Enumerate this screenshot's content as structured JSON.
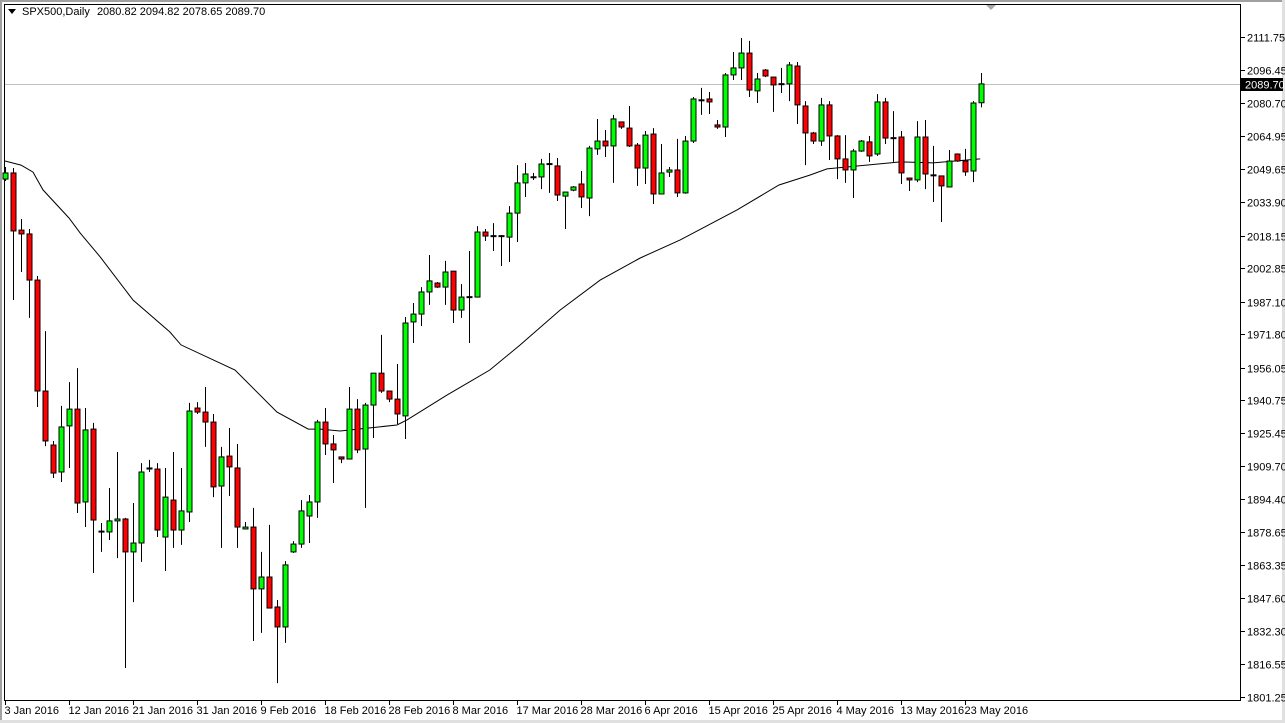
{
  "header": {
    "symbol": "SPX500,Daily",
    "open": "2080.82",
    "high": "2094.82",
    "low": "2078.65",
    "close": "2089.70"
  },
  "colors": {
    "bull": "#00ff00",
    "bear": "#ff0000",
    "outline": "#000000",
    "ma": "#000000",
    "price_line": "#c0c0c0"
  },
  "chart_data": {
    "type": "candlestick",
    "title": "SPX500,Daily",
    "xlabel": "",
    "ylabel": "",
    "ylim": [
      1801.25,
      2111.75
    ],
    "grid": false,
    "current_price": "2089.70",
    "y_ticks": [
      "2111.75",
      "2096.45",
      "2080.70",
      "2064.95",
      "2049.65",
      "2033.90",
      "2018.15",
      "2002.85",
      "1987.10",
      "1971.80",
      "1956.05",
      "1940.75",
      "1925.45",
      "1909.70",
      "1894.40",
      "1878.65",
      "1863.35",
      "1847.60",
      "1832.30",
      "1816.55",
      "1801.25"
    ],
    "x_ticks": [
      {
        "bar": 0,
        "label": "3 Jan 2016"
      },
      {
        "bar": 8,
        "label": "12 Jan 2016"
      },
      {
        "bar": 16,
        "label": "21 Jan 2016"
      },
      {
        "bar": 24,
        "label": "31 Jan 2016"
      },
      {
        "bar": 32,
        "label": "9 Feb 2016"
      },
      {
        "bar": 40,
        "label": "18 Feb 2016"
      },
      {
        "bar": 48,
        "label": "28 Feb 2016"
      },
      {
        "bar": 56,
        "label": "8 Mar 2016"
      },
      {
        "bar": 64,
        "label": "17 Mar 2016"
      },
      {
        "bar": 72,
        "label": "28 Mar 2016"
      },
      {
        "bar": 80,
        "label": "6 Apr 2016"
      },
      {
        "bar": 88,
        "label": "15 Apr 2016"
      },
      {
        "bar": 96,
        "label": "25 Apr 2016"
      },
      {
        "bar": 104,
        "label": "4 May 2016"
      },
      {
        "bar": 112,
        "label": "13 May 2016"
      },
      {
        "bar": 120,
        "label": "23 May 2016"
      }
    ],
    "ohlc_fields": [
      "open",
      "high",
      "low",
      "close"
    ],
    "ohlc": [
      [
        2044.9,
        2050.6,
        2044.0,
        2047.8
      ],
      [
        2047.8,
        2050.1,
        1988.0,
        2020.5
      ],
      [
        2020.9,
        2026.1,
        2001.2,
        2019.1
      ],
      [
        2019.1,
        2021.4,
        1979.6,
        1997.4
      ],
      [
        1997.4,
        1999.3,
        1937.7,
        1945.2
      ],
      [
        1945.2,
        1973.4,
        1919.3,
        1921.7
      ],
      [
        1919.8,
        1921.7,
        1904.3,
        1906.6
      ],
      [
        1907.1,
        1938.2,
        1902.4,
        1928.3
      ],
      [
        1928.8,
        1949.4,
        1909.0,
        1936.7
      ],
      [
        1936.7,
        1956.0,
        1887.8,
        1892.5
      ],
      [
        1893.0,
        1937.2,
        1881.2,
        1926.9
      ],
      [
        1927.3,
        1930.2,
        1859.6,
        1884.5
      ],
      [
        1878.9,
        1883.1,
        1869.5,
        1879.3
      ],
      [
        1878.9,
        1899.6,
        1875.1,
        1884.1
      ],
      [
        1884.1,
        1916.5,
        1866.6,
        1885.0
      ],
      [
        1885.0,
        1885.5,
        1814.9,
        1869.5
      ],
      [
        1869.5,
        1892.5,
        1845.9,
        1873.7
      ],
      [
        1873.7,
        1911.3,
        1864.8,
        1907.1
      ],
      [
        1908.5,
        1912.8,
        1907.1,
        1909.0
      ],
      [
        1908.5,
        1911.3,
        1876.5,
        1879.8
      ],
      [
        1876.5,
        1909.0,
        1860.5,
        1895.3
      ],
      [
        1893.9,
        1916.5,
        1871.4,
        1879.8
      ],
      [
        1879.8,
        1909.0,
        1872.8,
        1888.8
      ],
      [
        1888.3,
        1939.6,
        1883.6,
        1935.8
      ],
      [
        1937.2,
        1940.0,
        1934.4,
        1935.3
      ],
      [
        1935.3,
        1947.1,
        1918.9,
        1930.6
      ],
      [
        1930.6,
        1934.4,
        1895.3,
        1900.1
      ],
      [
        1900.5,
        1918.9,
        1871.4,
        1914.2
      ],
      [
        1914.6,
        1927.8,
        1895.8,
        1909.5
      ],
      [
        1909.0,
        1920.3,
        1871.4,
        1881.2
      ],
      [
        1880.3,
        1883.6,
        1880.3,
        1881.2
      ],
      [
        1881.2,
        1890.2,
        1827.6,
        1852.1
      ],
      [
        1852.1,
        1869.5,
        1831.4,
        1857.7
      ],
      [
        1857.7,
        1882.2,
        1843.1,
        1843.1
      ],
      [
        1843.6,
        1846.9,
        1807.8,
        1834.2
      ],
      [
        1834.2,
        1865.2,
        1826.7,
        1863.4
      ],
      [
        1869.5,
        1874.6,
        1869.0,
        1873.2
      ],
      [
        1873.2,
        1893.9,
        1871.4,
        1888.8
      ],
      [
        1886.4,
        1896.3,
        1873.7,
        1893.0
      ],
      [
        1893.0,
        1931.6,
        1885.5,
        1930.6
      ],
      [
        1930.6,
        1937.2,
        1915.1,
        1920.3
      ],
      [
        1920.3,
        1924.5,
        1901.9,
        1917.5
      ],
      [
        1914.2,
        1914.2,
        1911.3,
        1913.2
      ],
      [
        1913.2,
        1947.1,
        1913.2,
        1936.7
      ],
      [
        1936.7,
        1941.4,
        1916.0,
        1917.5
      ],
      [
        1917.9,
        1939.6,
        1890.2,
        1938.6
      ],
      [
        1938.6,
        1953.6,
        1923.1,
        1953.6
      ],
      [
        1953.6,
        1971.6,
        1944.3,
        1945.2
      ],
      [
        1945.2,
        1945.2,
        1940.0,
        1941.4
      ],
      [
        1941.4,
        1957.9,
        1929.7,
        1934.4
      ],
      [
        1933.5,
        1980.0,
        1922.6,
        1977.2
      ],
      [
        1977.7,
        1986.6,
        1967.8,
        1981.4
      ],
      [
        1981.4,
        1994.1,
        1975.8,
        1991.8
      ],
      [
        1991.8,
        2009.2,
        1985.7,
        1997.0
      ],
      [
        1996.0,
        1996.5,
        1993.7,
        1994.1
      ],
      [
        1994.1,
        2006.4,
        1985.7,
        2001.2
      ],
      [
        2001.6,
        2001.6,
        1977.2,
        1983.3
      ],
      [
        1983.3,
        1995.5,
        1979.6,
        1989.4
      ],
      [
        1989.2,
        2011.1,
        1967.8,
        1989.6
      ],
      [
        1989.4,
        2022.8,
        1989.4,
        2020.0
      ],
      [
        2020.0,
        2021.4,
        2015.8,
        2018.1
      ],
      [
        2018.1,
        2024.2,
        2011.1,
        2018.3
      ],
      [
        2017.9,
        2018.5,
        2004.0,
        2018.3
      ],
      [
        2017.6,
        2032.2,
        2005.9,
        2028.9
      ],
      [
        2028.9,
        2051.5,
        2015.3,
        2043.1
      ],
      [
        2043.1,
        2052.5,
        2036.5,
        2047.3
      ],
      [
        2046.0,
        2047.8,
        2044.5,
        2045.8
      ],
      [
        2045.9,
        2054.4,
        2040.2,
        2052.0
      ],
      [
        2052.0,
        2057.2,
        2038.4,
        2052.2
      ],
      [
        2051.1,
        2054.8,
        2034.6,
        2037.4
      ],
      [
        2036.9,
        2038.8,
        2021.4,
        2038.8
      ],
      [
        2039.7,
        2041.6,
        2039.2,
        2041.2
      ],
      [
        2042.6,
        2048.7,
        2031.3,
        2036.5
      ],
      [
        2036.0,
        2060.5,
        2027.5,
        2059.5
      ],
      [
        2059.1,
        2073.2,
        2056.3,
        2062.8
      ],
      [
        2062.8,
        2068.0,
        2055.3,
        2060.5
      ],
      [
        2060.5,
        2075.1,
        2043.1,
        2073.2
      ],
      [
        2071.8,
        2071.8,
        2068.5,
        2069.4
      ],
      [
        2068.9,
        2079.3,
        2060.0,
        2060.5
      ],
      [
        2060.9,
        2061.9,
        2041.7,
        2050.1
      ],
      [
        2050.1,
        2067.5,
        2042.6,
        2065.6
      ],
      [
        2066.1,
        2068.9,
        2033.2,
        2037.9
      ],
      [
        2037.9,
        2061.4,
        2037.9,
        2047.8
      ],
      [
        2048.2,
        2050.6,
        2045.9,
        2049.2
      ],
      [
        2049.2,
        2063.8,
        2036.5,
        2038.4
      ],
      [
        2038.4,
        2065.2,
        2038.0,
        2062.8
      ],
      [
        2062.8,
        2083.5,
        2061.9,
        2082.6
      ],
      [
        2082.0,
        2087.8,
        2075.1,
        2082.2
      ],
      [
        2082.6,
        2085.9,
        2075.5,
        2081.2
      ],
      [
        2070.4,
        2072.7,
        2068.5,
        2069.4
      ],
      [
        2069.4,
        2094.8,
        2064.7,
        2093.9
      ],
      [
        2093.9,
        2104.7,
        2091.5,
        2097.2
      ],
      [
        2097.2,
        2111.3,
        2091.5,
        2104.2
      ],
      [
        2104.2,
        2109.9,
        2083.5,
        2086.8
      ],
      [
        2086.4,
        2094.8,
        2080.7,
        2092.0
      ],
      [
        2096.2,
        2096.7,
        2092.9,
        2093.4
      ],
      [
        2092.9,
        2092.9,
        2076.5,
        2089.2
      ],
      [
        2089.8,
        2097.2,
        2085.4,
        2089.6
      ],
      [
        2089.7,
        2100.0,
        2081.6,
        2098.6
      ],
      [
        2098.1,
        2100.0,
        2070.8,
        2079.8
      ],
      [
        2079.3,
        2081.6,
        2051.5,
        2066.6
      ],
      [
        2066.6,
        2067.1,
        2061.4,
        2062.8
      ],
      [
        2062.8,
        2083.1,
        2060.5,
        2079.8
      ],
      [
        2079.8,
        2081.6,
        2053.9,
        2065.2
      ],
      [
        2065.2,
        2065.6,
        2044.9,
        2054.4
      ],
      [
        2054.4,
        2065.6,
        2043.1,
        2049.2
      ],
      [
        2049.2,
        2059.1,
        2036.0,
        2058.1
      ],
      [
        2058.1,
        2063.3,
        2057.7,
        2062.8
      ],
      [
        2062.4,
        2065.2,
        2053.0,
        2055.8
      ],
      [
        2056.7,
        2084.9,
        2055.8,
        2081.2
      ],
      [
        2081.2,
        2083.1,
        2061.4,
        2064.2
      ],
      [
        2064.4,
        2076.9,
        2053.0,
        2064.2
      ],
      [
        2064.7,
        2067.5,
        2042.6,
        2047.8
      ],
      [
        2045.4,
        2045.4,
        2039.3,
        2044.5
      ],
      [
        2044.5,
        2072.2,
        2043.5,
        2064.7
      ],
      [
        2064.7,
        2072.7,
        2040.2,
        2047.3
      ],
      [
        2046.9,
        2060.5,
        2034.1,
        2046.7
      ],
      [
        2046.4,
        2046.4,
        2024.7,
        2041.7
      ],
      [
        2041.2,
        2058.6,
        2041.2,
        2053.4
      ],
      [
        2056.7,
        2057.0,
        2053.0,
        2053.4
      ],
      [
        2053.4,
        2059.1,
        2046.4,
        2048.3
      ],
      [
        2048.7,
        2081.6,
        2043.5,
        2080.7
      ],
      [
        2080.82,
        2094.82,
        2078.65,
        2089.7
      ]
    ],
    "moving_average": [
      [
        0,
        2053.4
      ],
      [
        2,
        2051.5
      ],
      [
        3.5,
        2048.2
      ],
      [
        4.75,
        2039.8
      ],
      [
        8,
        2026.6
      ],
      [
        9.4,
        2019.5
      ],
      [
        11.9,
        2008.3
      ],
      [
        16,
        1988.0
      ],
      [
        20.6,
        1973.0
      ],
      [
        22,
        1966.9
      ],
      [
        28.75,
        1955.1
      ],
      [
        34,
        1935.3
      ],
      [
        37.9,
        1927.3
      ],
      [
        39.4,
        1927.3
      ],
      [
        41.9,
        1926.4
      ],
      [
        49,
        1929.2
      ],
      [
        50.25,
        1931.6
      ],
      [
        55.25,
        1943.3
      ],
      [
        60.6,
        1955.1
      ],
      [
        64.4,
        1966.9
      ],
      [
        69.4,
        1983.3
      ],
      [
        74.4,
        1997.4
      ],
      [
        79.4,
        2007.8
      ],
      [
        84.4,
        2016.3
      ],
      [
        91.5,
        2030.4
      ],
      [
        96.75,
        2042.1
      ],
      [
        100.6,
        2046.8
      ],
      [
        102.75,
        2049.7
      ],
      [
        111.9,
        2053.0
      ],
      [
        116,
        2052.5
      ],
      [
        121.9,
        2054.4
      ]
    ]
  }
}
